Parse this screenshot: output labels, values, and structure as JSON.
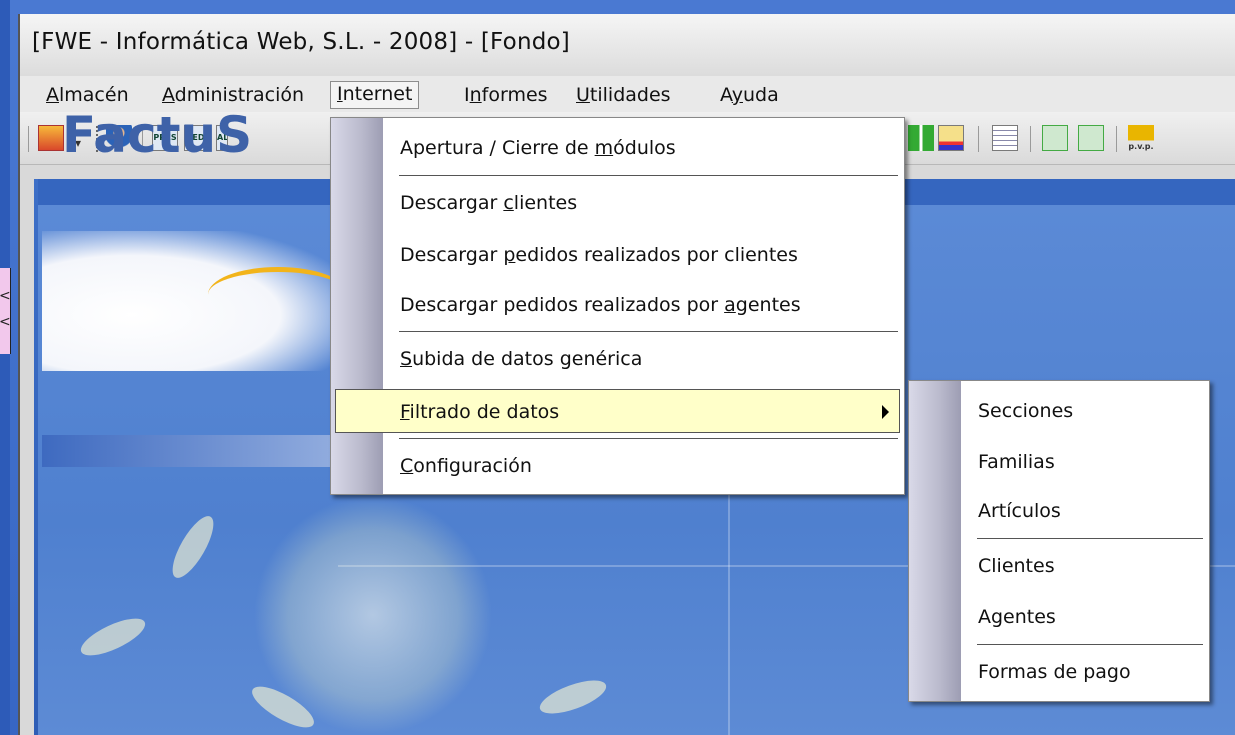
{
  "window": {
    "title": "[FWE - Informática Web, S.L. - 2008] - [Fondo]"
  },
  "menubar": [
    {
      "id": "almacen",
      "pre": "",
      "ul": "A",
      "post": "lmacén"
    },
    {
      "id": "administracion",
      "pre": "",
      "ul": "A",
      "post": "dministración"
    },
    {
      "id": "internet",
      "pre": "",
      "ul": "I",
      "post": "nternet"
    },
    {
      "id": "informes",
      "pre": "I",
      "ul": "n",
      "post": "formes"
    },
    {
      "id": "utilidades",
      "pre": "",
      "ul": "U",
      "post": "tilidades"
    },
    {
      "id": "ayuda",
      "pre": "A",
      "ul": "y",
      "post": "uda"
    }
  ],
  "toolbar": {
    "icon_labels": [
      "PRES",
      "PEDI",
      "ALB"
    ],
    "right_label": "p.v.p."
  },
  "background": {
    "logo_text": "FactuS"
  },
  "pink_tab": {
    "chars": [
      "<",
      "<"
    ]
  },
  "internet_menu": [
    {
      "pre": "Apertura / Cierre de ",
      "ul": "m",
      "post": "ódulos"
    },
    {
      "pre": "Descargar ",
      "ul": "c",
      "post": "lientes"
    },
    {
      "pre": "Descargar ",
      "ul": "p",
      "post": "edidos realizados por clientes"
    },
    {
      "pre": "Descargar pedidos realizados por ",
      "ul": "a",
      "post": "gentes"
    },
    {
      "pre": "",
      "ul": "S",
      "post": "ubida de datos genérica"
    },
    {
      "pre": "",
      "ul": "F",
      "post": "iltrado de datos"
    },
    {
      "pre": "",
      "ul": "C",
      "post": "onfiguración"
    }
  ],
  "filtrado_submenu": [
    {
      "label": "Secciones"
    },
    {
      "label": "Familias"
    },
    {
      "label": "Artículos"
    },
    {
      "label": "Clientes"
    },
    {
      "label": "Agentes"
    },
    {
      "label": "Formas de pago"
    }
  ],
  "colors": {
    "highlight": "#ffffc9",
    "desktop": "#3f6ec9",
    "logo": "#3e62a8",
    "logo_arc": "#f2b41b"
  }
}
